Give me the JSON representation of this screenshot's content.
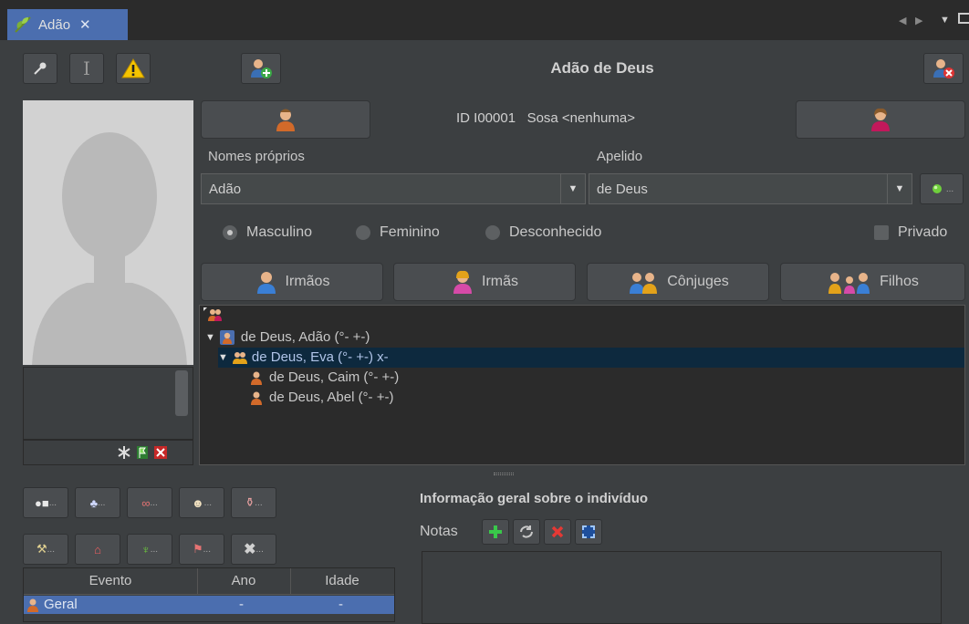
{
  "tab": {
    "label": "Adão",
    "close": "✕"
  },
  "toolbar": {
    "title": "Adão de Deus",
    "text_tool": "I",
    "warning": "!"
  },
  "person": {
    "id_text": "ID I00001",
    "sosa_text": "Sosa <nenhuma>",
    "given_names_label": "Nomes próprios",
    "given_names_value": "Adão",
    "surname_label": "Apelido",
    "surname_value": "de Deus",
    "gender_options": [
      "Masculino",
      "Feminino",
      "Desconhecido"
    ],
    "gender_selected": "Masculino",
    "private_label": "Privado"
  },
  "relatives_buttons": {
    "brothers": "Irmãos",
    "sisters": "Irmãs",
    "spouses": "Cônjuges",
    "children": "Filhos"
  },
  "tree": [
    {
      "text": "de Deus, Adão (°- +-)",
      "level": 0,
      "expanded": true
    },
    {
      "text": "de Deus, Eva (°- +-) x-",
      "level": 1,
      "expanded": true,
      "selected": true
    },
    {
      "text": "de Deus, Caim (°- +-)",
      "level": 2
    },
    {
      "text": "de Deus, Abel (°- +-)",
      "level": 2
    }
  ],
  "event_buttons_ellipsis": "...",
  "events_table": {
    "headers": [
      "Evento",
      "Ano",
      "Idade"
    ],
    "rows": [
      [
        "Geral",
        "-",
        "-"
      ]
    ]
  },
  "info": {
    "title": "Informação geral sobre o indivíduo",
    "notes_label": "Notas"
  },
  "colors": {
    "selection": "#4b6eaf",
    "tree_selection": "#0d293e",
    "background": "#3c3f41"
  }
}
